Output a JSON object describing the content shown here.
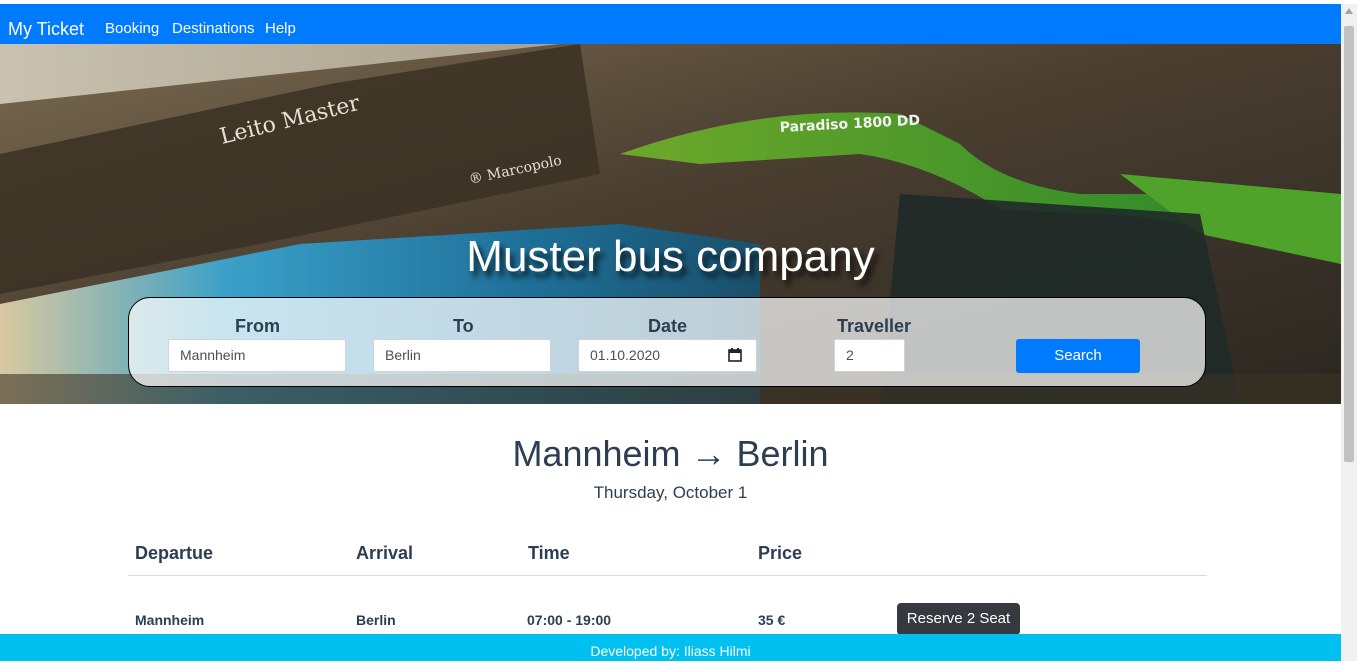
{
  "navbar": {
    "brand": "My Ticket",
    "items": [
      {
        "label": "Booking"
      },
      {
        "label": "Destinations"
      },
      {
        "label": "Help"
      }
    ]
  },
  "hero": {
    "title": "Muster bus company"
  },
  "search": {
    "from_label": "From",
    "from_value": "Mannheim",
    "to_label": "To",
    "to_value": "Berlin",
    "date_label": "Date",
    "date_value": "01.10.2020",
    "traveller_label": "Traveller",
    "traveller_value": "2",
    "button_label": "Search"
  },
  "route": {
    "title": "Mannheim → Berlin",
    "date": "Thursday, October 1"
  },
  "table": {
    "headers": [
      "Departue",
      "Arrival",
      "Time",
      "Price"
    ],
    "rows": [
      {
        "departure": "Mannheim",
        "arrival": "Berlin",
        "time": "07:00 - 19:00",
        "price": "35 €",
        "action": "Reserve 2 Seat"
      }
    ]
  },
  "footer": {
    "text": "Developed by: Iliass Hilmi"
  },
  "colors": {
    "primary": "#007bff",
    "dark_button": "#343a40",
    "footer": "#00c0f0",
    "text": "#2c3e50"
  }
}
